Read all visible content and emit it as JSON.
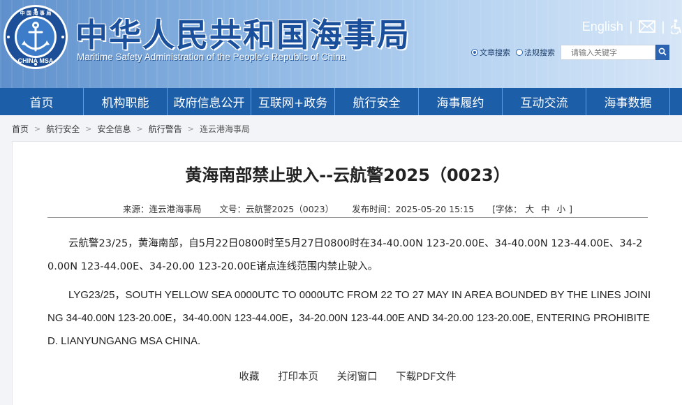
{
  "header": {
    "title_cn": "中华人民共和国海事局",
    "title_en": "Maritime Safety Administration of the People's Republic of China",
    "logo_text_top": "中 国 海 事 局",
    "logo_text_bottom": "CHINA MSA",
    "lang_link": "English",
    "divider": "|",
    "search": {
      "option_article": "文章搜索",
      "option_law": "法规搜索",
      "placeholder": "请输入关键字"
    }
  },
  "nav": {
    "items": [
      {
        "label": "首页"
      },
      {
        "label": "机构职能"
      },
      {
        "label": "政府信息公开"
      },
      {
        "label": "互联网+政务"
      },
      {
        "label": "航行安全"
      },
      {
        "label": "海事履约"
      },
      {
        "label": "互动交流"
      },
      {
        "label": "海事数据"
      }
    ]
  },
  "breadcrumb": {
    "items": [
      "首页",
      "航行安全",
      "安全信息",
      "航行警告",
      "连云港海事局"
    ],
    "sep": ">"
  },
  "article": {
    "title": "黄海南部禁止驶入--云航警2025（0023）",
    "meta": {
      "source": "来源：连云港海事局",
      "doc_no": "文号：云航警2025（0023）",
      "publish_time": "发布时间：2025-05-20 15:15",
      "font_label": "[字体：",
      "font_large": "大",
      "font_medium": "中",
      "font_small": "小",
      "font_close": "]"
    },
    "body_cn": "云航警23/25，黄海南部，自5月22日0800时至5月27日0800时在34-40.00N 123-20.00E、34-40.00N 123-44.00E、34-20.00N 123-44.00E、34-20.00 123-20.00E诸点连线范围内禁止驶入。",
    "body_en": "LYG23/25，SOUTH YELLOW SEA 0000UTC TO 0000UTC FROM 22 TO 27 MAY IN AREA BOUNDED BY THE LINES JOINING 34-40.00N 123-20.00E，34-40.00N 123-44.00E，34-20.00N 123-44.00E AND 34-20.00 123-20.00E, ENTERING PROHIBITED. LIANYUNGANG MSA CHINA.",
    "actions": {
      "favorite": "收藏",
      "print": "打印本页",
      "close": "关闭窗口",
      "download_pdf": "下载PDF文件"
    }
  },
  "colors": {
    "nav_bg": "#1d5ea8",
    "title_blue": "#1a4f9c",
    "search_btn": "#2b63b0"
  },
  "icons": {
    "mail": "mail-icon",
    "accessibility": "accessibility-icon",
    "search": "search-icon",
    "logo": "msa-emblem-icon"
  }
}
